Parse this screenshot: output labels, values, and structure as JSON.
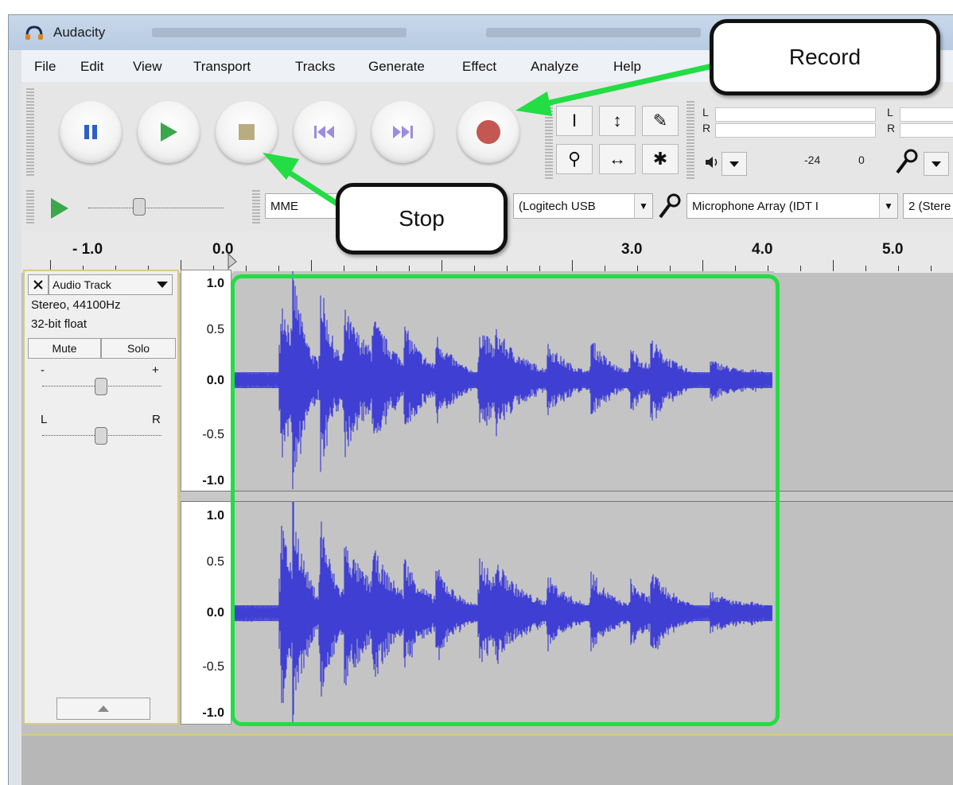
{
  "window": {
    "title": "Audacity"
  },
  "menu": [
    "File",
    "Edit",
    "View",
    "Transport",
    "Tracks",
    "Generate",
    "Effect",
    "Analyze",
    "Help"
  ],
  "transport": {
    "pause": "pause-icon",
    "play": "play-icon",
    "stop": "stop-icon",
    "skip_start": "skip-to-start-icon",
    "skip_end": "skip-to-end-icon",
    "record": "record-icon"
  },
  "tools": {
    "selection": "I",
    "envelope": "↕",
    "draw": "✎",
    "zoom": "⚲",
    "timeshift": "↔",
    "multi": "✱"
  },
  "meters": {
    "output_left": "L",
    "output_right": "R",
    "input_left": "L",
    "input_right": "R",
    "scale": [
      "-24",
      "0"
    ]
  },
  "device_bar": {
    "host": "MME",
    "output_device": "(Logitech USB",
    "input_device": "Microphone Array (IDT I",
    "channels": "2 (Stere"
  },
  "ruler": [
    "- 1.0",
    "0.0",
    "3.0",
    "4.0",
    "5.0"
  ],
  "track": {
    "name": "Audio Track",
    "format": "Stereo, 44100Hz",
    "bitdepth": "32-bit float",
    "mute": "Mute",
    "solo": "Solo",
    "gain_min": "-",
    "gain_max": "+",
    "pan_left": "L",
    "pan_right": "R",
    "collapse_icon": "triangle-up-icon"
  },
  "scale_labels": [
    "1.0",
    "0.5",
    "0.0",
    "-0.5",
    "-1.0"
  ],
  "callouts": {
    "record": "Record",
    "stop": "Stop"
  },
  "colors": {
    "waveform": "#3f3fd4",
    "highlight": "#22dd44",
    "record": "#c0504d"
  }
}
